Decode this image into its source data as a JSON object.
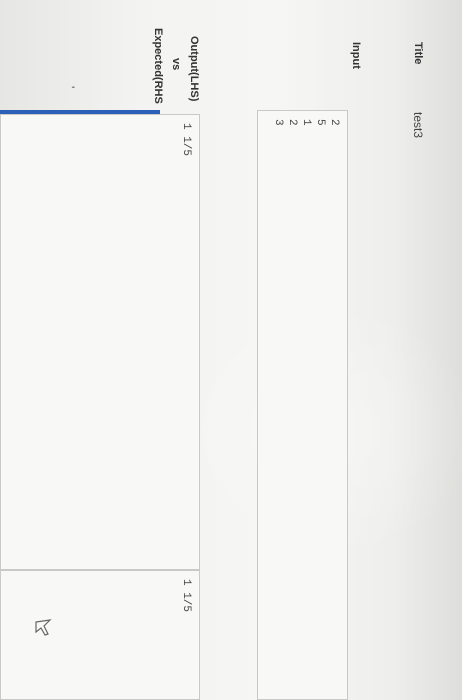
{
  "title_label": "Title",
  "title_value": "test3",
  "input_label": "Input",
  "input_lines": [
    "2",
    "5",
    "1",
    "2",
    "3"
  ],
  "output_label_line1": "Output(LHS)",
  "output_label_line2": "vs",
  "output_label_line3": "Expected(RHS",
  "output_lhs_lines": [
    "1 1/5"
  ],
  "expected_rhs_lines": [
    "1 1/5"
  ],
  "colors": {
    "accent": "#2b5fb8",
    "panel_bg": "#f8f8f6",
    "panel_border": "#c9c9c6"
  },
  "icons": {
    "pointer": "arrow-cursor-icon"
  }
}
